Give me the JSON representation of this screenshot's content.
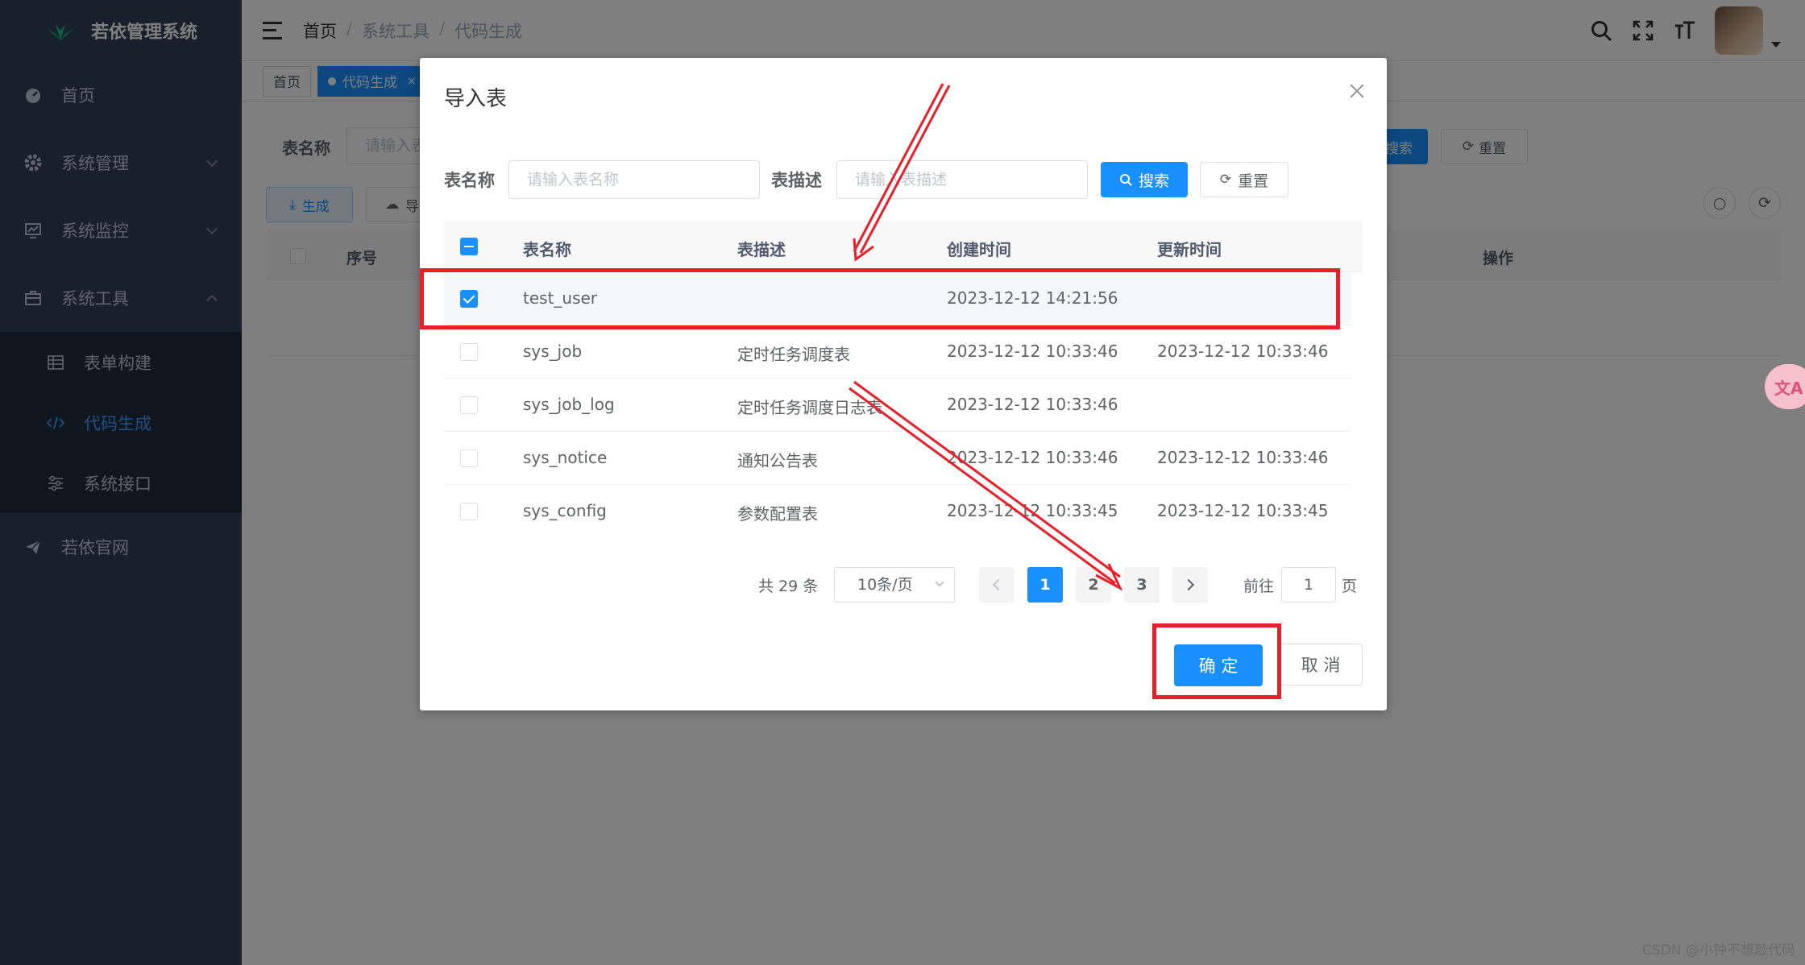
{
  "sidebar": {
    "app_title": "若依管理系统",
    "items": [
      {
        "label": "首页"
      },
      {
        "label": "系统管理"
      },
      {
        "label": "系统监控"
      },
      {
        "label": "系统工具"
      }
    ],
    "sub_items": [
      {
        "label": "表单构建"
      },
      {
        "label": "代码生成"
      },
      {
        "label": "系统接口"
      }
    ],
    "external": {
      "label": "若依官网"
    }
  },
  "header": {
    "breadcrumb": [
      "首页",
      "系统工具",
      "代码生成"
    ],
    "separator": "/"
  },
  "tags": {
    "home": "首页",
    "active": "代码生成",
    "close": "×"
  },
  "page": {
    "search_label": "表名称",
    "search_placeholder": "请输入表",
    "search_btn": "搜索",
    "reset_btn": "重置",
    "generate_btn": "生成",
    "import_btn": "导",
    "col_index": "序号",
    "col_action": "操作"
  },
  "dialog": {
    "title": "导入表",
    "form": {
      "name_label": "表名称",
      "name_placeholder": "请输入表名称",
      "desc_label": "表描述",
      "desc_placeholder": "请输入表描述",
      "search_btn": "搜索",
      "reset_btn": "重置"
    },
    "columns": [
      "表名称",
      "表描述",
      "创建时间",
      "更新时间"
    ],
    "rows": [
      {
        "name": "test_user",
        "desc": "",
        "created": "2023-12-12 14:21:56",
        "updated": "",
        "checked": true
      },
      {
        "name": "sys_job",
        "desc": "定时任务调度表",
        "created": "2023-12-12 10:33:46",
        "updated": "2023-12-12 10:33:46",
        "checked": false
      },
      {
        "name": "sys_job_log",
        "desc": "定时任务调度日志表",
        "created": "2023-12-12 10:33:46",
        "updated": "",
        "checked": false
      },
      {
        "name": "sys_notice",
        "desc": "通知公告表",
        "created": "2023-12-12 10:33:46",
        "updated": "2023-12-12 10:33:46",
        "checked": false
      },
      {
        "name": "sys_config",
        "desc": "参数配置表",
        "created": "2023-12-12 10:33:45",
        "updated": "2023-12-12 10:33:45",
        "checked": false
      }
    ],
    "pagination": {
      "total": "共 29 条",
      "page_size": "10条/页",
      "pages": [
        "1",
        "2",
        "3"
      ],
      "current": "1",
      "goto_label": "前往",
      "goto_value": "1",
      "page_suffix": "页"
    },
    "confirm_btn": "确 定",
    "cancel_btn": "取 消"
  },
  "fab": {
    "label": "文A"
  },
  "watermark": "CSDN @小钟不想敲代码",
  "colors": {
    "primary": "#1890ff",
    "sidebar_bg": "#304156",
    "annotation_red": "#e8202a"
  }
}
